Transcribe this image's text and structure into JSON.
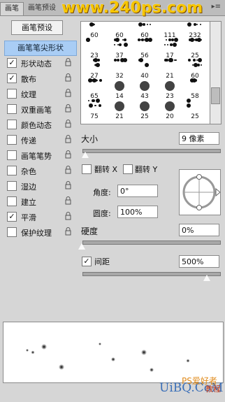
{
  "tabs": [
    {
      "label": "画笔"
    },
    {
      "label": "画笔预设"
    }
  ],
  "watermark": "www.240ps.com",
  "preset_button": "画笔预设",
  "tip_shape": "画笔笔尖形状",
  "options": [
    {
      "label": "形状动态",
      "checked": true,
      "lock": true
    },
    {
      "label": "散布",
      "checked": true,
      "lock": true
    },
    {
      "label": "纹理",
      "checked": false,
      "lock": true
    },
    {
      "label": "双重画笔",
      "checked": false,
      "lock": true
    },
    {
      "label": "颜色动态",
      "checked": false,
      "lock": true
    },
    {
      "label": "传递",
      "checked": false,
      "lock": true
    },
    {
      "label": "画笔笔势",
      "checked": false,
      "lock": true
    },
    {
      "label": "杂色",
      "checked": false,
      "lock": true
    },
    {
      "label": "湿边",
      "checked": false,
      "lock": true
    },
    {
      "label": "建立",
      "checked": false,
      "lock": true
    },
    {
      "label": "平滑",
      "checked": true,
      "lock": true
    },
    {
      "label": "保护纹理",
      "checked": false,
      "lock": true
    }
  ],
  "brush_sizes": [
    [
      "60",
      "60",
      "60",
      "111",
      "232"
    ],
    [
      "23",
      "37",
      "56",
      "17",
      "25"
    ],
    [
      "27",
      "32",
      "40",
      "21",
      "60"
    ],
    [
      "65",
      "14",
      "43",
      "23",
      "58"
    ],
    [
      "75",
      "21",
      "25",
      "20",
      "25"
    ]
  ],
  "size": {
    "label": "大小",
    "value": "9 像素"
  },
  "flip_x": {
    "label": "翻转 X",
    "checked": false
  },
  "flip_y": {
    "label": "翻转 Y",
    "checked": false
  },
  "angle": {
    "label": "角度:",
    "value": "0°"
  },
  "roundness": {
    "label": "圆度:",
    "value": "100%"
  },
  "hardness": {
    "label": "硬度",
    "value": "0%"
  },
  "spacing": {
    "label": "间距",
    "value": "500%",
    "checked": true
  },
  "footer": {
    "logo": "UiBQ.CoM",
    "cn1": "PS爱好者",
    "cn2": "教程"
  }
}
